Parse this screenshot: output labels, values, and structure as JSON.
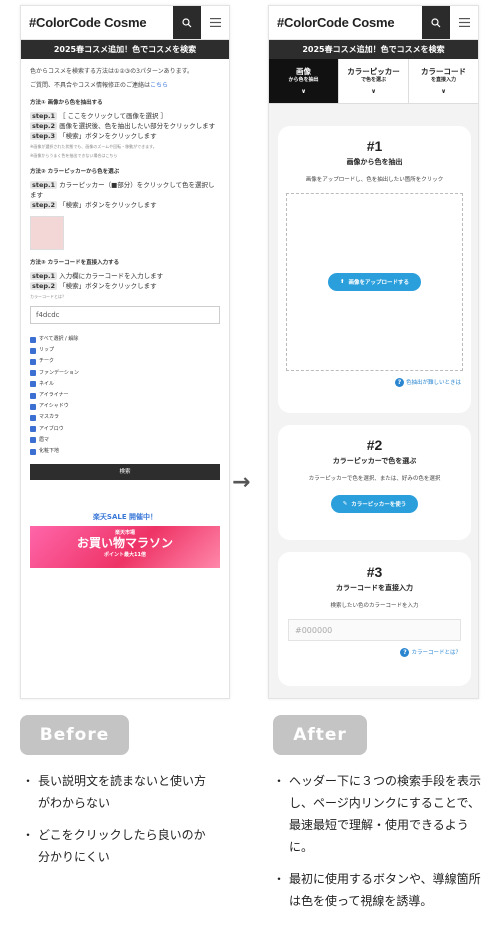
{
  "app": {
    "logo": "#ColorCode Cosme",
    "banner": "2025春コスメ追加！色でコスメを検索"
  },
  "before": {
    "intro": "色からコスメを検索する方法は①②③の3パターンあります。",
    "contact": "ご質問、不具合やコスメ情報修正のご連絡は",
    "contact_link": "こちら",
    "method1": {
      "heading": "方法① 画像から色を抽出する",
      "steps": [
        {
          "label": "step.1",
          "text": "［ ここをクリックして画像を選択 ］"
        },
        {
          "label": "step.2",
          "text": "画像を選択後、色を抽出したい部分をクリックします"
        },
        {
          "label": "step.3",
          "text": "「検索」ボタンをクリックします"
        }
      ],
      "note": "※画像が選択された状態でも、画像のズームや回転・移動ができます。",
      "note2": "※画像からうまく色を抽出できない場合はこちら"
    },
    "method2": {
      "heading": "方法② カラーピッカーから色を選ぶ",
      "steps": [
        {
          "label": "step.1",
          "text": "カラーピッカー（■部分）をクリックして色を選択します"
        },
        {
          "label": "step.2",
          "text": "「検索」ボタンをクリックします"
        }
      ]
    },
    "method3": {
      "heading": "方法③ カラーコードを直接入力する",
      "steps": [
        {
          "label": "step.1",
          "text": "入力欄にカラーコードを入力します"
        },
        {
          "label": "step.2",
          "text": "「検索」ボタンをクリックします"
        }
      ],
      "link": "カラーコードとは？",
      "input_value": "f4dcdc"
    },
    "categories": [
      "すべて選択 / 解除",
      "リップ",
      "チーク",
      "ファンデーション",
      "ネイル",
      "アイライナー",
      "アイシャドウ",
      "マスカラ",
      "アイブロウ",
      "眉マ",
      "化粧下地"
    ],
    "search_button": "検索",
    "sale_title": "楽天SALE 開催中！",
    "sale_sub": "楽天市場",
    "sale_main": "お買い物マラソン",
    "sale_points": "ポイント最大11倍"
  },
  "after": {
    "tabs": [
      {
        "label": "画像",
        "sub": "から色を抽出"
      },
      {
        "label": "カラーピッカー",
        "sub": "で色を選ぶ"
      },
      {
        "label": "カラーコード",
        "sub": "を直接入力"
      }
    ],
    "card1": {
      "num": "#1",
      "title": "画像から色を抽出",
      "desc": "画像をアップロードし、色を抽出したい箇所をクリック",
      "button": "画像をアップロードする",
      "help": "色抽出が難しいときは"
    },
    "card2": {
      "num": "#2",
      "title": "カラーピッカーで色を選ぶ",
      "desc": "カラーピッカーで色を選択、または、好みの色を選択",
      "button": "カラーピッカーを使う"
    },
    "card3": {
      "num": "#3",
      "title": "カラーコードを直接入力",
      "desc": "検索したい色のカラーコードを入力",
      "placeholder": "#000000",
      "help": "カラーコードとは？"
    }
  },
  "labels": {
    "before": "Before",
    "after": "After"
  },
  "notes_before": [
    "長い説明文を読まないと使い方がわからない",
    "どこをクリックしたら良いのか分かりにくい"
  ],
  "notes_after": [
    "ヘッダー下に３つの検索手段を表示し、ページ内リンクにすることで、最速最短で理解・使用できるように。",
    "最初に使用するボタンや、導線箇所は色を使って視線を誘導。"
  ]
}
